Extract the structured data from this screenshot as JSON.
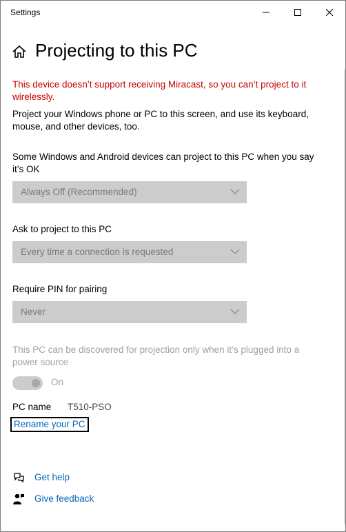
{
  "window": {
    "title": "Settings"
  },
  "header": {
    "title": "Projecting to this PC"
  },
  "warning": "This device doesn’t support receiving Miracast, so you can’t project to it wirelessly.",
  "intro": "Project your Windows phone or PC to this screen, and use its keyboard, mouse, and other devices, too.",
  "settings": {
    "availability": {
      "label": "Some Windows and Android devices can project to this PC when you say it’s OK",
      "value": "Always Off (Recommended)"
    },
    "ask": {
      "label": "Ask to project to this PC",
      "value": "Every time a connection is requested"
    },
    "pin": {
      "label": "Require PIN for pairing",
      "value": "Never"
    },
    "discover": {
      "label": "This PC can be discovered for projection only when it’s plugged into a power source",
      "state": "On"
    }
  },
  "pc": {
    "label": "PC name",
    "value": "T510-PSO",
    "rename_link": "Rename your PC"
  },
  "help": {
    "get_help": "Get help",
    "give_feedback": "Give feedback"
  },
  "icons": {
    "home": "home-icon",
    "help": "help-chat-icon",
    "feedback": "feedback-person-icon"
  },
  "colors": {
    "warning": "#c50500",
    "link": "#0067c0",
    "disabled": "#cccccc"
  }
}
